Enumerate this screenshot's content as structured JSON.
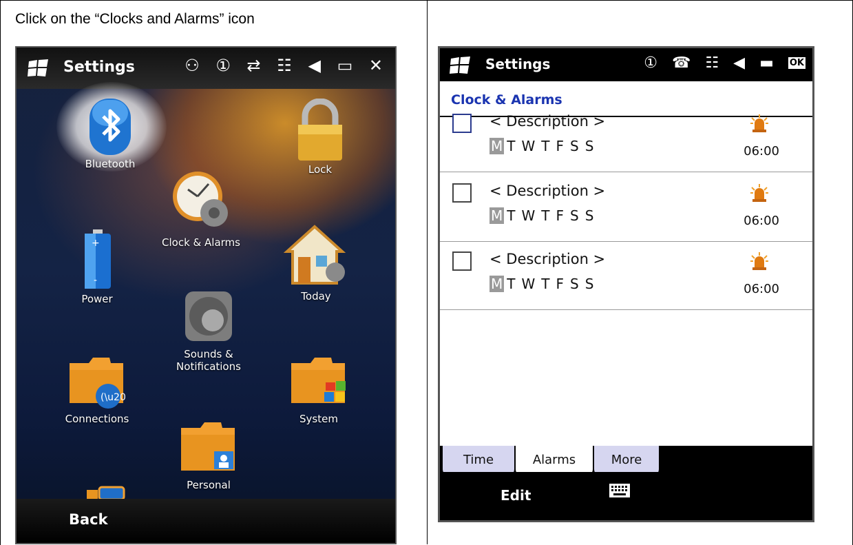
{
  "caption": "Click on the “Clocks and Alarms” icon",
  "left_screen": {
    "title": "Settings",
    "status_icons": "♳ ① ⇄ ▉ ◀ ▭",
    "close_label": "✕",
    "tiles": [
      {
        "label": "Bluetooth"
      },
      {
        "label": "Clock & Alarms"
      },
      {
        "label": "Lock"
      },
      {
        "label": "Power"
      },
      {
        "label": "Today"
      },
      {
        "label": "Sounds & Notifications"
      },
      {
        "label": "Connections"
      },
      {
        "label": "System"
      },
      {
        "label": "Personal"
      }
    ],
    "back_label": "Back"
  },
  "right_screen": {
    "title": "Settings",
    "status_icons": "① ☎ ▉ ◀ ▬",
    "ok_label": "OK",
    "page_title": "Clock & Alarms",
    "alarms": [
      {
        "description": "< Description >",
        "days": [
          "M",
          "T",
          "W",
          "T",
          "F",
          "S",
          "S"
        ],
        "time": "06:00",
        "checked": false
      },
      {
        "description": "< Description >",
        "days": [
          "M",
          "T",
          "W",
          "T",
          "F",
          "S",
          "S"
        ],
        "time": "06:00",
        "checked": false
      },
      {
        "description": "< Description >",
        "days": [
          "M",
          "T",
          "W",
          "T",
          "F",
          "S",
          "S"
        ],
        "time": "06:00",
        "checked": false
      }
    ],
    "tabs": [
      {
        "label": "Time"
      },
      {
        "label": "Alarms"
      },
      {
        "label": "More"
      }
    ],
    "active_tab": "Alarms",
    "softkey_left": "Edit",
    "icons": {
      "keyboard": "keyboard-icon",
      "alarm": "alarm-bell-icon",
      "windows": "windows-flag-icon"
    }
  },
  "colors": {
    "accent_title": "#1a34b0",
    "tab_bg": "#d6d6f0",
    "day_highlight": "#9a9a9a"
  }
}
